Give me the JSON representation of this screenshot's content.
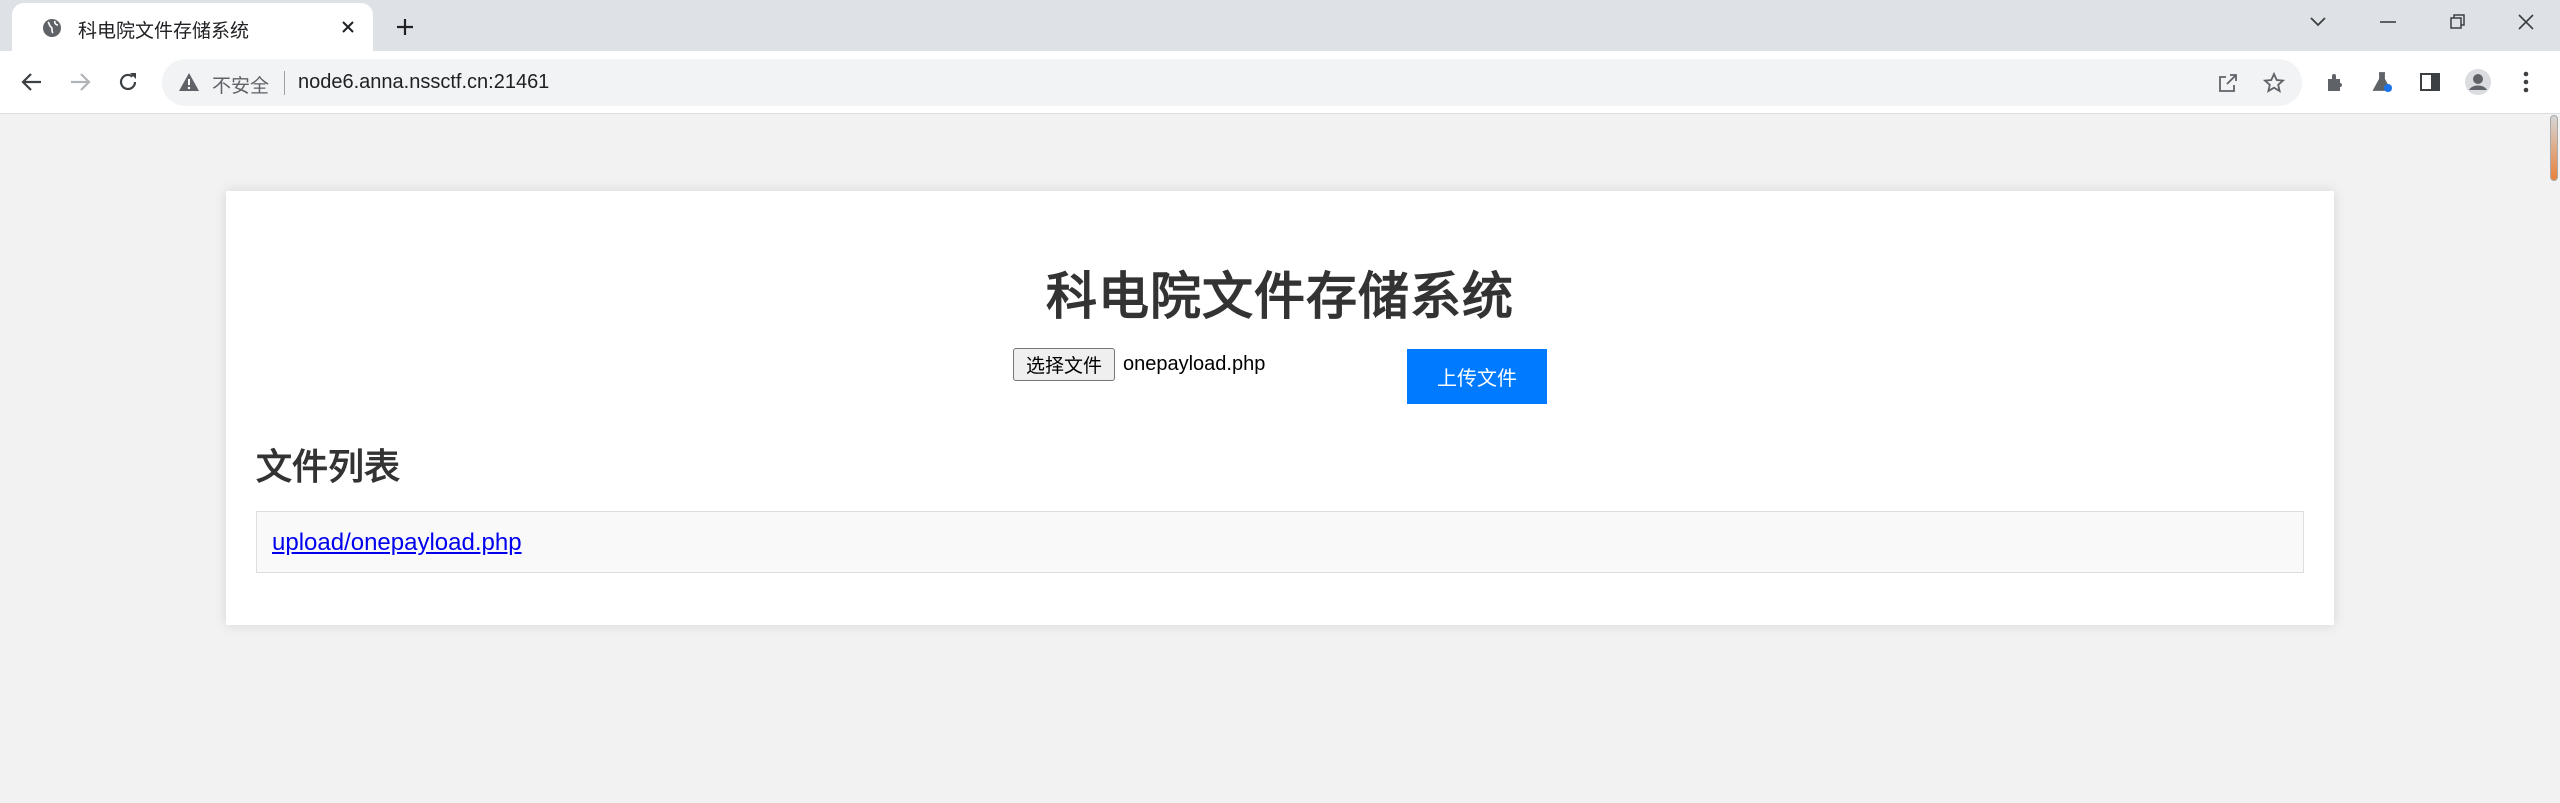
{
  "browser": {
    "tab_title": "科电院文件存储系统",
    "tab_favicon": "globe-icon",
    "new_tab_icon": "plus-icon",
    "security_label": "不安全",
    "url": "node6.anna.nssctf.cn:21461",
    "window_controls": [
      "chevron-down-icon",
      "minimize-icon",
      "restore-icon",
      "close-icon"
    ],
    "nav_icons": [
      "back-arrow-icon",
      "forward-arrow-icon",
      "reload-icon"
    ],
    "omnibox_icons": [
      "share-icon",
      "star-icon"
    ],
    "toolbar_icons": [
      "extensions-icon",
      "labs-flask-icon",
      "side-panel-icon",
      "profile-avatar-icon",
      "more-vert-icon"
    ]
  },
  "page": {
    "title": "科电院文件存储系统",
    "upload_form": {
      "choose_button_label": "选择文件",
      "selected_file": "onepayload.php",
      "submit_label": "上传文件"
    },
    "file_list": {
      "heading": "文件列表",
      "items": [
        "upload/onepayload.php"
      ]
    }
  },
  "colors": {
    "primary_button": "#007bff",
    "link": "#0000ee",
    "page_background": "#f2f2f2",
    "card_background": "#ffffff"
  }
}
